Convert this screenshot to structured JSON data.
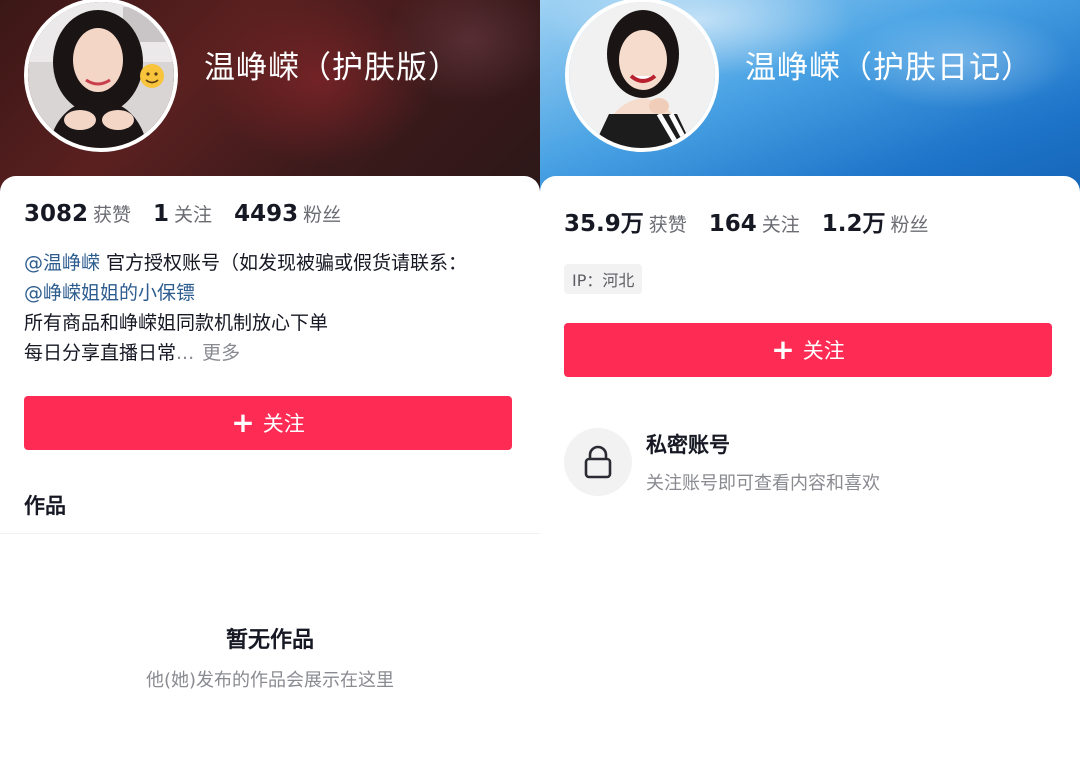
{
  "left_profile": {
    "nickname": "温峥嵘（护肤版）",
    "stats": [
      {
        "value": "3082",
        "label": "获赞"
      },
      {
        "value": "1",
        "label": "关注"
      },
      {
        "value": "4493",
        "label": "粉丝"
      }
    ],
    "bio": {
      "line1_mention": "@温峥嵘",
      "line1_text": " 官方授权账号（如发现被骗或假货请联系：",
      "line2_mention": "@峥嵘姐姐的小保镖",
      "line3": "所有商品和峥嵘姐同款机制放心下单",
      "line4": "每日分享直播日常",
      "line4_ellipsis": "...",
      "more": "更多"
    },
    "follow_button": {
      "plus": "+",
      "label": "关注"
    },
    "works_tab": "作品",
    "empty_title": "暂无作品",
    "empty_subtitle": "他(她)发布的作品会展示在这里"
  },
  "right_profile": {
    "nickname": "温峥嵘（护肤日记）",
    "stats": [
      {
        "value": "35.9万",
        "label": "获赞"
      },
      {
        "value": "164",
        "label": "关注"
      },
      {
        "value": "1.2万",
        "label": "粉丝"
      }
    ],
    "ip_tag": "IP：河北",
    "follow_button": {
      "plus": "+",
      "label": "关注"
    },
    "private_title": "私密账号",
    "private_subtitle": "关注账号即可查看内容和喜欢"
  },
  "colors": {
    "accent": "#fe2c55",
    "mention": "#2d5c8f",
    "text_primary": "#161823",
    "text_secondary": "#8a8b91"
  },
  "icons": {
    "lock": "lock-icon",
    "emoji_sticker": "smiling-face-emoji"
  }
}
